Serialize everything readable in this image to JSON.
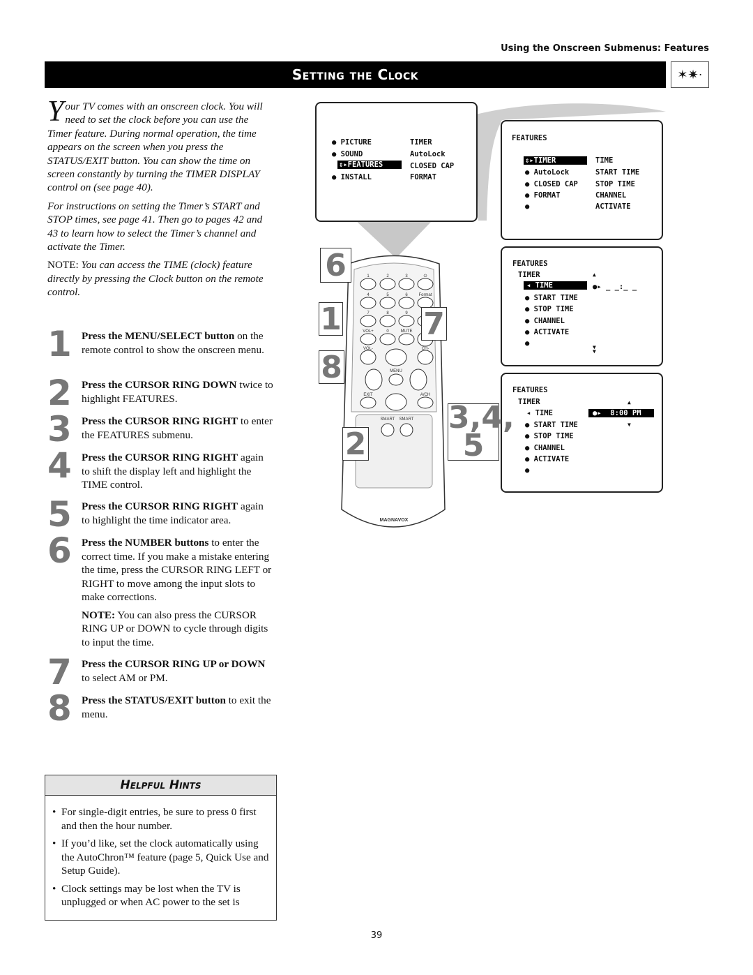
{
  "header": {
    "section": "Using the Onscreen Submenus: Features"
  },
  "title": "Setting the Clock",
  "title_icon": "stars-icon",
  "intro": {
    "dropcap": "Y",
    "p1": "our TV comes with an onscreen clock. You will need to set the clock before you can use the Timer feature. During normal operation, the time appears on the screen when you press the STATUS/EXIT button. You can show the time on screen constantly by turning the TIMER DISPLAY control on (see page 40).",
    "p2": "For instructions on setting the Timer’s START and STOP times, see page 41. Then go to pages 42 and 43 to learn how to select the Timer’s channel and activate the Timer.",
    "note_label": "NOTE:",
    "note": " You can access the TIME (clock) feature directly by pressing the Clock button on the remote control."
  },
  "steps": [
    {
      "num": "1",
      "bold": "Press the MENU/SELECT button",
      "rest": " on the remote control to show the onscreen menu."
    },
    {
      "num": "2",
      "bold": "Press the CURSOR RING DOWN",
      "rest": " twice to highlight FEATURES."
    },
    {
      "num": "3",
      "bold": "Press the CURSOR RING RIGHT",
      "rest": " to enter the FEATURES submenu."
    },
    {
      "num": "4",
      "bold": "Press the CURSOR RING RIGHT",
      "rest": " again to shift the display left and highlight the TIME control."
    },
    {
      "num": "5",
      "bold": "Press the CURSOR RING RIGHT",
      "rest": " again to highlight the time indicator area."
    },
    {
      "num": "6",
      "bold": "Press the NUMBER buttons",
      "rest": " to enter the correct time. If you make a mistake entering the time, press the CURSOR RING LEFT or RIGHT to move among the input slots to make corrections.",
      "note_label": "NOTE:",
      "note": " You can also press the CURSOR RING UP or DOWN to cycle through digits to input the time."
    },
    {
      "num": "7",
      "bold": "Press the CURSOR RING UP or DOWN",
      "rest": " to select AM or PM."
    },
    {
      "num": "8",
      "bold": "Press the STATUS/EXIT button",
      "rest": " to exit the menu."
    }
  ],
  "hints": {
    "title": "Helpful Hints",
    "items": [
      "For single-digit entries, be sure to press 0 first and then the hour number.",
      "If you’d like, set the clock automatically using the AutoChron™ feature (page 5, Quick Use and Setup Guide).",
      "Clock settings may be lost when the TV is unplugged or when AC power to the set is"
    ]
  },
  "screen1": {
    "left": [
      "PICTURE",
      "SOUND",
      "FEATURES",
      "INSTALL"
    ],
    "right": [
      "TIMER",
      "AutoLock",
      "CLOSED CAP",
      "FORMAT"
    ],
    "selected": "FEATURES"
  },
  "screen2": {
    "title": "FEATURES",
    "left": [
      "TIMER",
      "AutoLock",
      "CLOSED CAP",
      "FORMAT",
      ""
    ],
    "right": [
      "TIME",
      "START TIME",
      "STOP TIME",
      "CHANNEL",
      "ACTIVATE"
    ]
  },
  "screen3": {
    "title": "FEATURES",
    "sub": "TIMER",
    "items": [
      "TIME",
      "START TIME",
      "STOP TIME",
      "CHANNEL",
      "ACTIVATE",
      ""
    ],
    "value": "_ _:_ _"
  },
  "screen4": {
    "title": "FEATURES",
    "sub": "TIMER",
    "items": [
      "TIME",
      "START TIME",
      "STOP TIME",
      "CHANNEL",
      "ACTIVATE",
      ""
    ],
    "value": "8:00 PM"
  },
  "remote": {
    "brand": "MAGNAVOX",
    "keys": [
      "1",
      "2",
      "3",
      "⏻",
      "4",
      "5",
      "6",
      "Format",
      "7",
      "8",
      "9",
      "",
      "VOL+",
      "0",
      "MUTE",
      "CH+",
      "VOL-",
      "CH-",
      "MENU",
      "EXIT",
      "A/CH",
      "SMART",
      "SMART"
    ]
  },
  "callouts": [
    "6",
    "1",
    "7",
    "8",
    "2",
    "3,4,",
    "5"
  ],
  "page_number": "39"
}
